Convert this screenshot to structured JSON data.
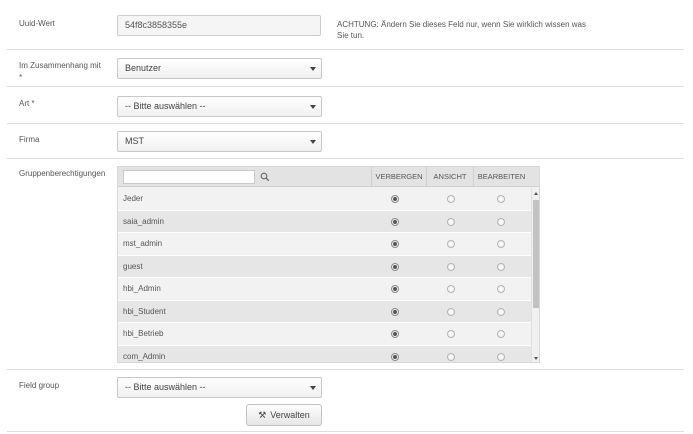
{
  "uuid": {
    "label": "Uuid-Wert",
    "value": "54f8c3858355e",
    "warning": "ACHTUNG: Ändern Sie dieses Feld nur, wenn Sie wirklich wissen was Sie tun."
  },
  "context": {
    "label": "Im Zusammenhang mit *",
    "selected": "Benutzer"
  },
  "type": {
    "label": "Art *",
    "selected": "-- Bitte auswählen --"
  },
  "company": {
    "label": "Firma",
    "selected": "MST"
  },
  "permissions": {
    "label": "Gruppenberechtigungen",
    "search_placeholder": "",
    "columns": [
      "VERBERGEN",
      "ANSICHT",
      "BEARBEITEN"
    ],
    "rows": [
      {
        "name": "Jeder",
        "selected": "VERBERGEN"
      },
      {
        "name": "saia_admin",
        "selected": "VERBERGEN"
      },
      {
        "name": "mst_admin",
        "selected": "VERBERGEN"
      },
      {
        "name": "guest",
        "selected": "VERBERGEN"
      },
      {
        "name": "hbi_Admin",
        "selected": "VERBERGEN"
      },
      {
        "name": "hbi_Student",
        "selected": "VERBERGEN"
      },
      {
        "name": "hbi_Betrieb",
        "selected": "VERBERGEN"
      },
      {
        "name": "com_Admin",
        "selected": "VERBERGEN"
      }
    ]
  },
  "field_group": {
    "label": "Field group",
    "selected": "-- Bitte auswählen --"
  },
  "manage_button": {
    "label": "Verwalten",
    "icon": "tools-icon"
  }
}
